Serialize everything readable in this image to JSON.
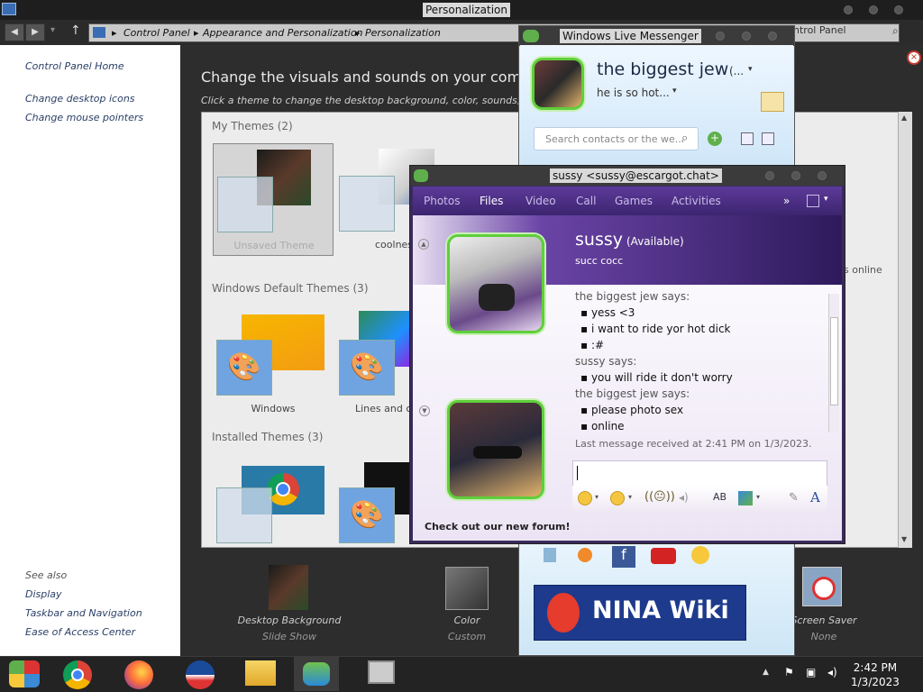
{
  "personalization": {
    "window_title": "Personalization",
    "breadcrumb": [
      "Control Panel",
      "Appearance and Personalization",
      "Personalization"
    ],
    "search_placeholder": "ntrol Panel",
    "sidebar": {
      "home": "Control Panel Home",
      "links": [
        "Change desktop icons",
        "Change mouse pointers"
      ],
      "see_also_label": "See also",
      "see_also": [
        "Display",
        "Taskbar and Navigation",
        "Ease of Access Center"
      ]
    },
    "heading": "Change the visuals and sounds on your computer",
    "subheading": "Click a theme to change the desktop background, color, sounds, and scr",
    "my_themes": {
      "label": "My Themes (2)",
      "items": [
        "Unsaved Theme",
        "coolnes"
      ]
    },
    "default_themes": {
      "label": "Windows Default Themes (3)",
      "items": [
        "Windows",
        "Lines and c"
      ]
    },
    "installed_themes": {
      "label": "Installed Themes (3)"
    },
    "partial_text": "s online",
    "bottom": [
      {
        "label": "Desktop Background",
        "sub": "Slide Show"
      },
      {
        "label": "Color",
        "sub": "Custom"
      },
      {
        "label": "Screen Saver",
        "sub": "None"
      }
    ]
  },
  "messenger": {
    "window_title": "Windows Live Messenger",
    "name": "the biggest jew",
    "name_suffix": "(...",
    "status_message": "he is so hot...",
    "search_placeholder": "Search contacts or the we...",
    "ad_text": "NINA Wiki"
  },
  "chat": {
    "window_title": "sussy <sussy@escargot.chat>",
    "tabs": [
      "Photos",
      "Files",
      "Video",
      "Call",
      "Games",
      "Activities",
      "»"
    ],
    "contact_name": "sussy",
    "contact_status": "(Available)",
    "contact_message": "succ cocc",
    "messages": [
      {
        "type": "header",
        "text": "the biggest jew says:"
      },
      {
        "type": "line",
        "text": "yess <3"
      },
      {
        "type": "line",
        "text": "i want to ride yor hot dick"
      },
      {
        "type": "line",
        "text": ":#"
      },
      {
        "type": "header",
        "text": "sussy says:"
      },
      {
        "type": "line",
        "text": "you will ride it don't worry"
      },
      {
        "type": "header",
        "text": "the biggest jew says:"
      },
      {
        "type": "line",
        "text": "please photo sex"
      },
      {
        "type": "line",
        "text": "online"
      }
    ],
    "last_received": "Last message received at 2:41 PM on 1/3/2023.",
    "footer_link": "Check out our new forum!"
  },
  "taskbar": {
    "time": "2:42 PM",
    "date": "1/3/2023"
  }
}
